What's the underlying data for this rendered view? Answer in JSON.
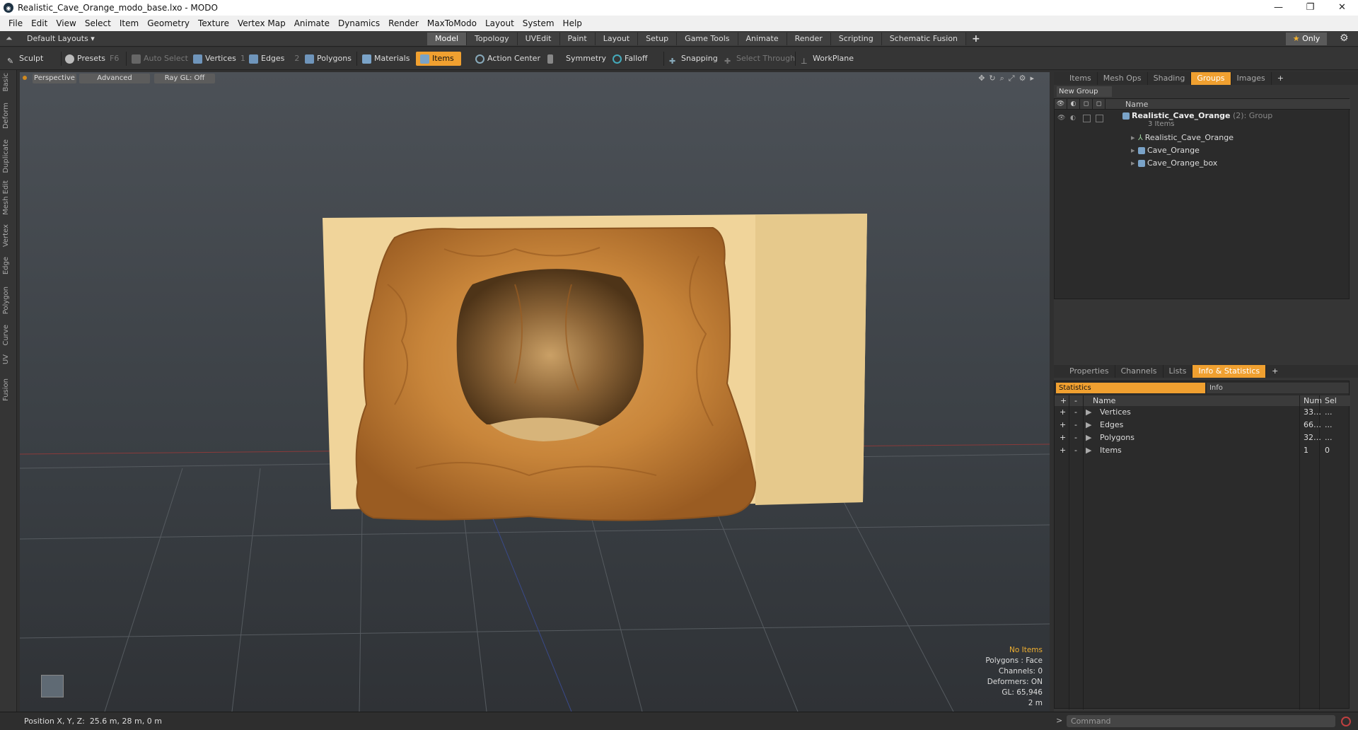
{
  "window": {
    "title": "Realistic_Cave_Orange_modo_base.lxo - MODO",
    "minimize": "—",
    "maximize": "❐",
    "close": "✕"
  },
  "menu": [
    "File",
    "Edit",
    "View",
    "Select",
    "Item",
    "Geometry",
    "Texture",
    "Vertex Map",
    "Animate",
    "Dynamics",
    "Render",
    "MaxToModo",
    "Layout",
    "System",
    "Help"
  ],
  "layoutbar": {
    "default_layouts": "Default Layouts ▾",
    "tabs": [
      "Model",
      "Topology",
      "UVEdit",
      "Paint",
      "Layout",
      "Setup",
      "Game Tools",
      "Animate",
      "Render",
      "Scripting",
      "Schematic Fusion"
    ],
    "active_tab": "Model",
    "plus": "+",
    "only": "Only",
    "star": "★"
  },
  "toolbar": {
    "sculpt": "Sculpt",
    "presets": "Presets",
    "presets_key": "F6",
    "auto_select": "Auto Select",
    "vertices": "Vertices",
    "vertices_count": "1",
    "edges": "Edges",
    "edges_count": "2",
    "polygons": "Polygons",
    "materials": "Materials",
    "items": "Items",
    "action_center": "Action Center",
    "symmetry": "Symmetry",
    "falloff": "Falloff",
    "snapping": "Snapping",
    "select_through": "Select Through",
    "workplane": "WorkPlane"
  },
  "left_tabs": [
    "Basic",
    "Deform",
    "Duplicate",
    "Mesh Edit",
    "Vertex",
    "Edge",
    "Polygon",
    "Curve",
    "UV",
    "Fusion"
  ],
  "viewport": {
    "perspective": "Perspective",
    "advanced": "Advanced",
    "raygl": "Ray GL: Off",
    "info": {
      "no_items": "No Items",
      "polygons": "Polygons : Face",
      "channels": "Channels: 0",
      "deformers": "Deformers: ON",
      "gl": "GL: 65,946",
      "scale": "2 m"
    }
  },
  "top_panel": {
    "tabs": [
      "Items",
      "Mesh Ops",
      "Shading",
      "Groups",
      "Images"
    ],
    "active_tab": "Groups",
    "plus": "+",
    "new_group": "New Group",
    "name_header": "Name",
    "group": {
      "name": "Realistic_Cave_Orange",
      "count": "(2)",
      "type": ": Group",
      "sub": "3 Items"
    },
    "children": [
      "Realistic_Cave_Orange",
      "Cave_Orange",
      "Cave_Orange_box"
    ]
  },
  "bottom_panel": {
    "tabs": [
      "Properties",
      "Channels",
      "Lists",
      "Info & Statistics"
    ],
    "active_tab": "Info & Statistics",
    "plus": "+",
    "statistics_tab": "Statistics",
    "info_tab": "Info",
    "headers": {
      "add": "+",
      "remove": "-",
      "name": "Name",
      "num": "Num",
      "sel": "Sel"
    },
    "rows": [
      {
        "name": "Vertices",
        "num": "33…",
        "sel": "..."
      },
      {
        "name": "Edges",
        "num": "66…",
        "sel": "..."
      },
      {
        "name": "Polygons",
        "num": "32…",
        "sel": "..."
      },
      {
        "name": "Items",
        "num": "1",
        "sel": "0"
      }
    ]
  },
  "statusbar": {
    "position_label": "Position X, Y, Z:",
    "position_value": "25.6 m, 28 m, 0 m",
    "prompt": ">",
    "command_placeholder": "Command"
  }
}
